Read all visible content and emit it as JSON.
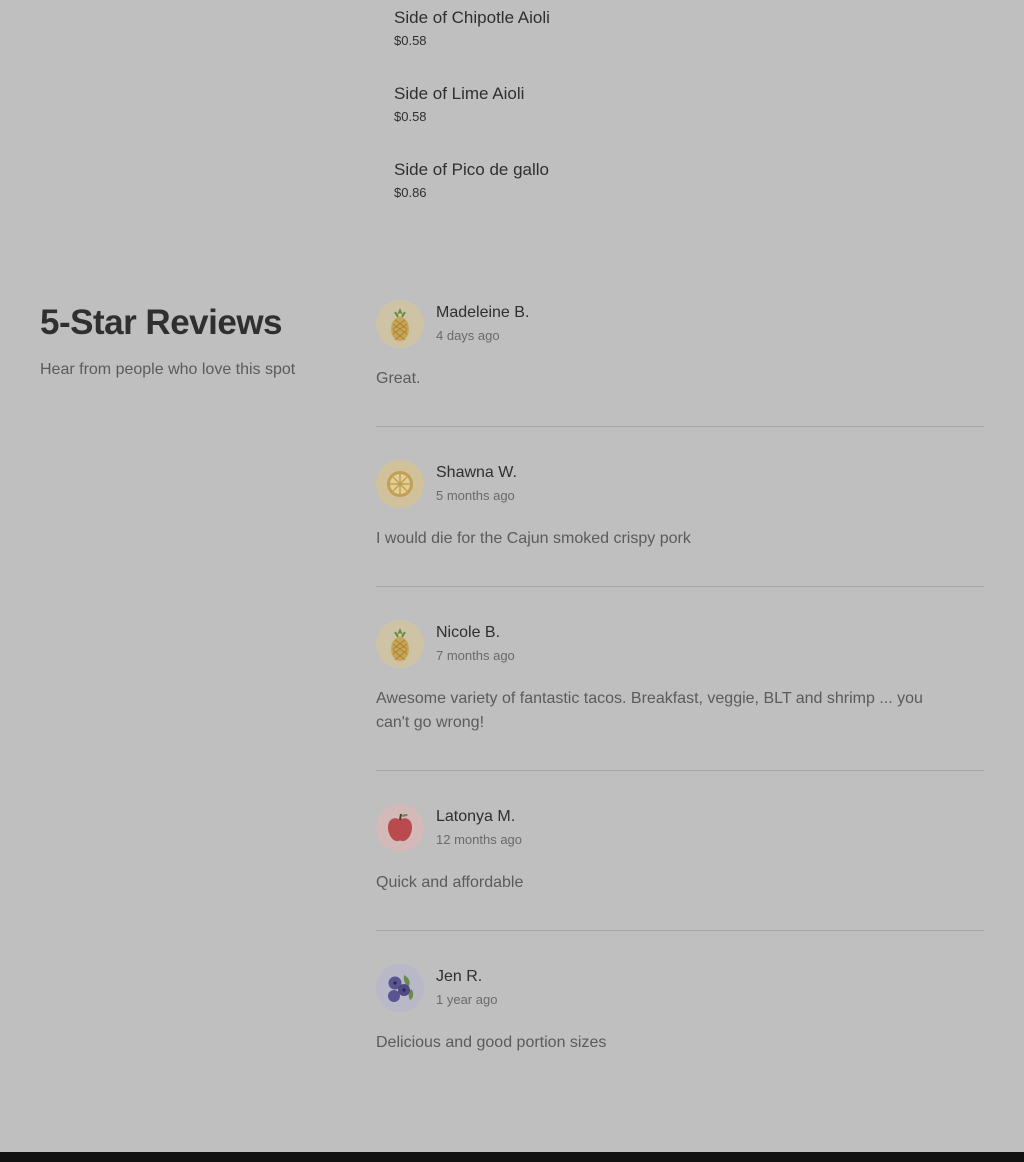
{
  "menu": {
    "items": [
      {
        "name": "Side of Chipotle Aioli",
        "price": "$0.58"
      },
      {
        "name": "Side of Lime Aioli",
        "price": "$0.58"
      },
      {
        "name": "Side of Pico de gallo",
        "price": "$0.86"
      }
    ]
  },
  "reviews_section": {
    "title": "5-Star Reviews",
    "subtitle": "Hear from people who love this spot"
  },
  "reviews": [
    {
      "name": "Madeleine B.",
      "time": "4 days ago",
      "text": "Great.",
      "avatar": "pineapple-icon",
      "avatar_bg": "#cfc3a6"
    },
    {
      "name": "Shawna W.",
      "time": "5 months ago",
      "text": "I would die for the Cajun smoked crispy pork",
      "avatar": "lemon-slice-icon",
      "avatar_bg": "#d2c29c"
    },
    {
      "name": "Nicole B.",
      "time": "7 months ago",
      "text": "Awesome variety of fantastic tacos. Breakfast, veggie, BLT and shrimp ... you can't go wrong!",
      "avatar": "pineapple-icon",
      "avatar_bg": "#cfc3a6"
    },
    {
      "name": "Latonya M.",
      "time": "12 months ago",
      "text": "Quick and affordable",
      "avatar": "apple-icon",
      "avatar_bg": "#d4b9b9"
    },
    {
      "name": "Jen R.",
      "time": "1 year ago",
      "text": "Delicious and good portion sizes",
      "avatar": "blueberry-icon",
      "avatar_bg": "#b9b8c8"
    }
  ]
}
